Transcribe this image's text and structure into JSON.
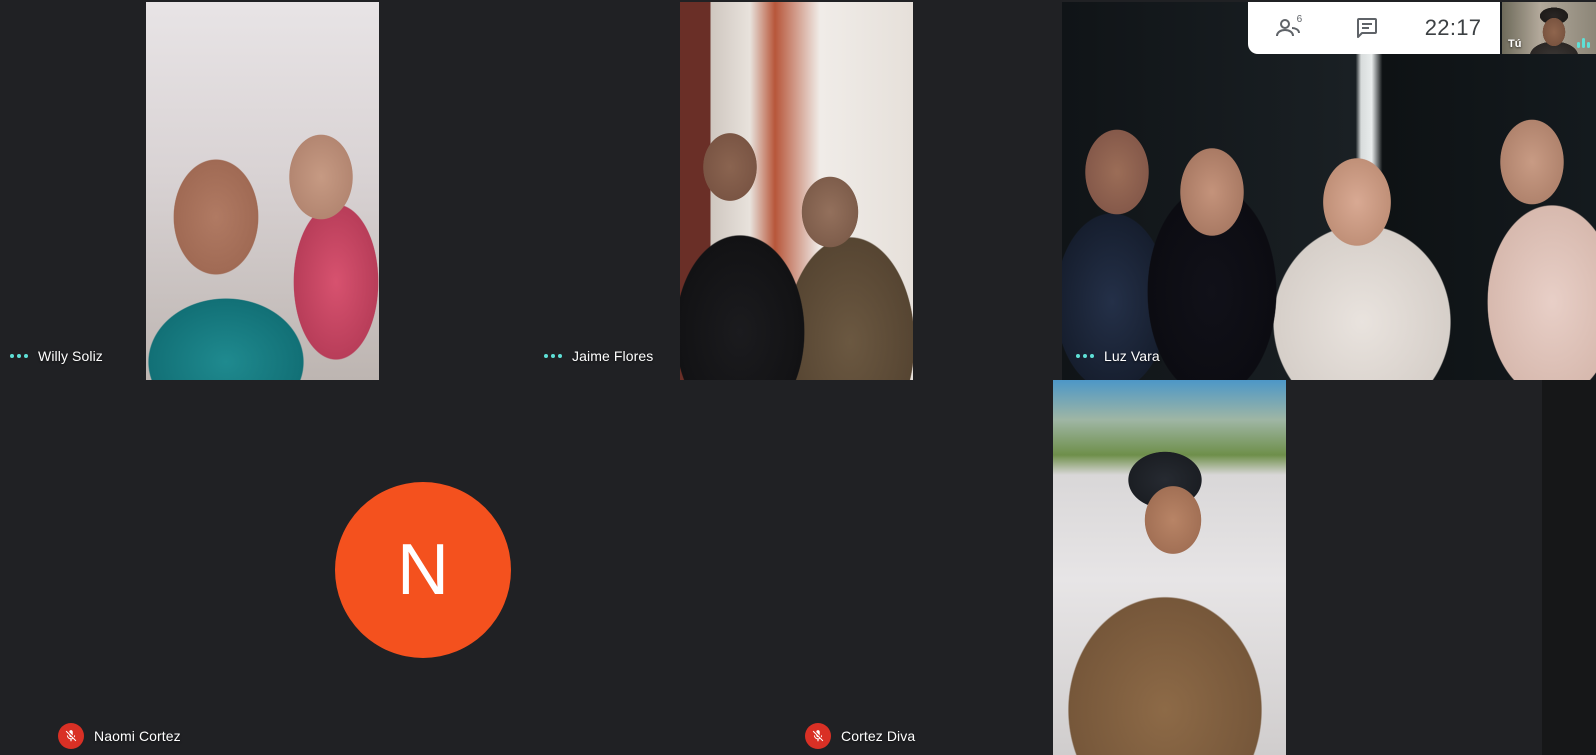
{
  "participants": {
    "willy": {
      "name": "Willy Soliz",
      "status": "speaking"
    },
    "jaime": {
      "name": "Jaime Flores",
      "status": "speaking"
    },
    "luz": {
      "name": "Luz Vara",
      "status": "speaking"
    },
    "naomi": {
      "name": "Naomi Cortez",
      "avatar_letter": "N",
      "avatar_color": "#f4511e",
      "status": "muted"
    },
    "cortez": {
      "name": "Cortez Diva",
      "status": "muted"
    }
  },
  "toolbar": {
    "participants_icon": "people-icon",
    "participant_count": "6",
    "chat_icon": "chat-icon",
    "clock": "22:17"
  },
  "self_view": {
    "label": "Tú"
  },
  "colors": {
    "background": "#202124",
    "speaking_indicator": "#5ee0d6",
    "muted": "#d93025"
  }
}
